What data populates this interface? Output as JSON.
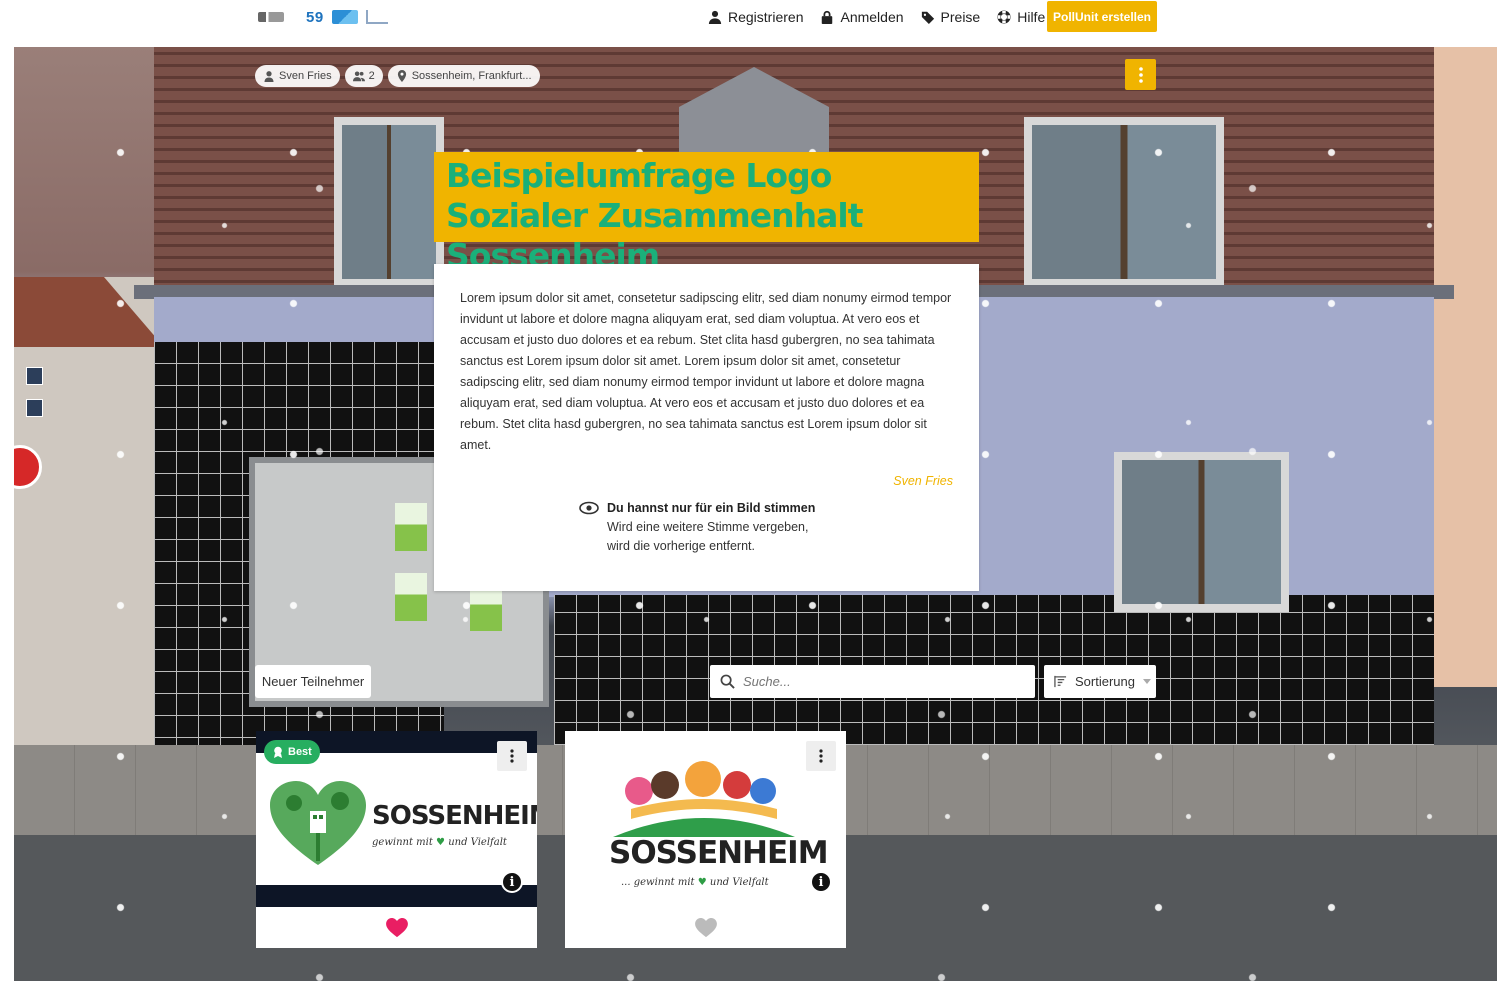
{
  "nav": {
    "logo_text": "59",
    "register": "Registrieren",
    "login": "Anmelden",
    "prices": "Preise",
    "help": "Hilfe",
    "create": "PollUnit erstellen"
  },
  "poll": {
    "author_chip": "Sven Fries",
    "participants_chip": "2",
    "location_chip": "Sossenheim, Frankfurt...",
    "title": "Beispielumfrage Logo Sozialer Zusammenhalt Sossenheim",
    "description": "Lorem ipsum dolor sit amet, consetetur sadipscing elitr, sed diam nonumy eirmod tempor invidunt ut labore et dolore magna aliquyam erat, sed diam voluptua. At vero eos et accusam et justo duo dolores et ea rebum. Stet clita hasd gubergren, no sea tahimata sanctus est Lorem ipsum dolor sit amet. Lorem ipsum dolor sit amet, consetetur sadipscing elitr, sed diam nonumy eirmod tempor invidunt ut labore et dolore magna aliquyam erat, sed diam voluptua. At vero eos et accusam et justo duo dolores et ea rebum. Stet clita hasd gubergren, no sea tahimata sanctus est Lorem ipsum dolor sit amet.",
    "signature": "Sven Fries",
    "vote_rule_title": "Du hannst nur für ein Bild stimmen",
    "vote_rule_line1": "Wird eine weitere Stimme vergeben,",
    "vote_rule_line2": "wird die vorherige entfernt."
  },
  "controls": {
    "new_participant": "Neuer Teilnehmer",
    "search_placeholder": "Suche...",
    "sort_label": "Sortierung"
  },
  "entries": [
    {
      "badge": "Best",
      "wordmark": "SOSSENHEIM",
      "tagline_a": "gewinnt mit",
      "tagline_b": "und Vielfalt",
      "info": "i",
      "voted": true
    },
    {
      "badge": "",
      "wordmark": "SOSSENHEIM",
      "tagline_a": "... gewinnt mit",
      "tagline_b": "und Vielfalt",
      "info": "i",
      "voted": false
    }
  ],
  "colors": {
    "accent": "#f0b400",
    "title_text": "#1ab07a",
    "best_badge": "#27ae60",
    "heart_active": "#e91e63",
    "heart_inactive": "#bbbbbb"
  },
  "icons": {
    "register": "user-icon",
    "login": "lock-icon",
    "prices": "price-tag-icon",
    "help": "lifebuoy-icon",
    "author": "user-icon",
    "participants": "users-icon",
    "location": "map-pin-icon",
    "vote_rule": "eye-icon",
    "search": "search-icon",
    "sort": "sort-icon",
    "menu": "more-vertical-icon",
    "vote": "heart-icon"
  }
}
